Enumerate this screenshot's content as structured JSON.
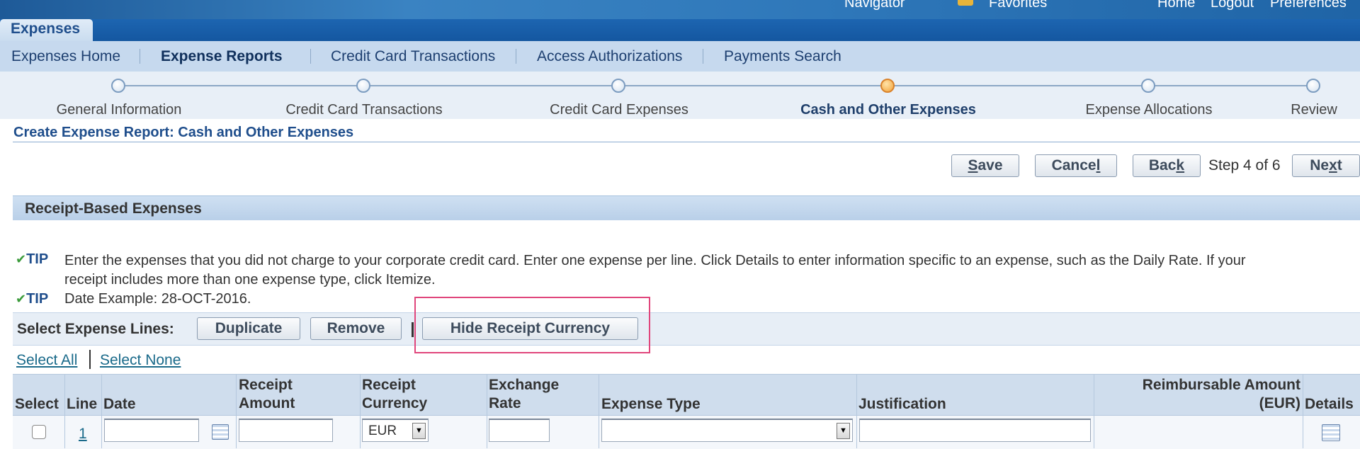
{
  "global_header": {
    "navigator": "Navigator",
    "favorites": "Favorites",
    "home": "Home",
    "logout": "Logout",
    "preferences": "Preferences"
  },
  "module_tab": "Expenses",
  "subnav": {
    "items": [
      {
        "label": "Expenses Home",
        "current": false
      },
      {
        "label": "Expense Reports",
        "current": true
      },
      {
        "label": "Credit Card Transactions",
        "current": false
      },
      {
        "label": "Access Authorizations",
        "current": false
      },
      {
        "label": "Payments Search",
        "current": false
      }
    ]
  },
  "train": {
    "steps": [
      "General Information",
      "Credit Card Transactions",
      "Credit Card Expenses",
      "Cash and Other Expenses",
      "Expense Allocations",
      "Review"
    ],
    "active_index": 3
  },
  "page": {
    "title": "Create Expense Report: Cash and Other Expenses",
    "buttons": {
      "save_pre": "",
      "save_acc": "S",
      "save_post": "ave",
      "cancel_pre": "Cance",
      "cancel_acc": "l",
      "cancel_post": "",
      "back_pre": "Bac",
      "back_acc": "k",
      "back_post": "",
      "next_pre": "Ne",
      "next_acc": "x",
      "next_post": "t"
    },
    "step_text": "Step 4 of 6"
  },
  "section": {
    "title": "Receipt-Based Expenses",
    "tip_word": "TIP",
    "tip1_line1": "Enter the expenses that you did not charge to your corporate credit card. Enter one expense per line. Click Details to enter information specific to an expense, such as the Daily Rate. If your",
    "tip1_line2": "receipt includes more than one expense type, click Itemize.",
    "tip2": "Date Example: 28-OCT-2016."
  },
  "select_bar": {
    "label": "Select Expense Lines:",
    "duplicate": "Duplicate",
    "remove": "Remove",
    "hide_receipt_currency": "Hide Receipt Currency"
  },
  "links": {
    "select_all": "Select All",
    "select_none": "Select None"
  },
  "table": {
    "headers": {
      "select": "Select",
      "line": "Line",
      "date": "Date",
      "receipt_amount_1": "Receipt",
      "receipt_amount_2": "Amount",
      "receipt_currency_1": "Receipt",
      "receipt_currency_2": "Currency",
      "exchange_rate_1": "Exchange",
      "exchange_rate_2": "Rate",
      "expense_type": "Expense Type",
      "justification": "Justification",
      "reimbursable_1": "Reimbursable Amount",
      "reimbursable_2": "(EUR)",
      "details": "Details"
    },
    "rows": [
      {
        "line": "1",
        "date": "",
        "receipt_amount": "",
        "receipt_currency": "EUR",
        "exchange_rate": "",
        "expense_type": "",
        "justification": "",
        "reimbursable": ""
      }
    ]
  },
  "colors": {
    "accent": "#1f4e8c",
    "highlight": "#e0467c",
    "active_step": "#f2a33a"
  }
}
